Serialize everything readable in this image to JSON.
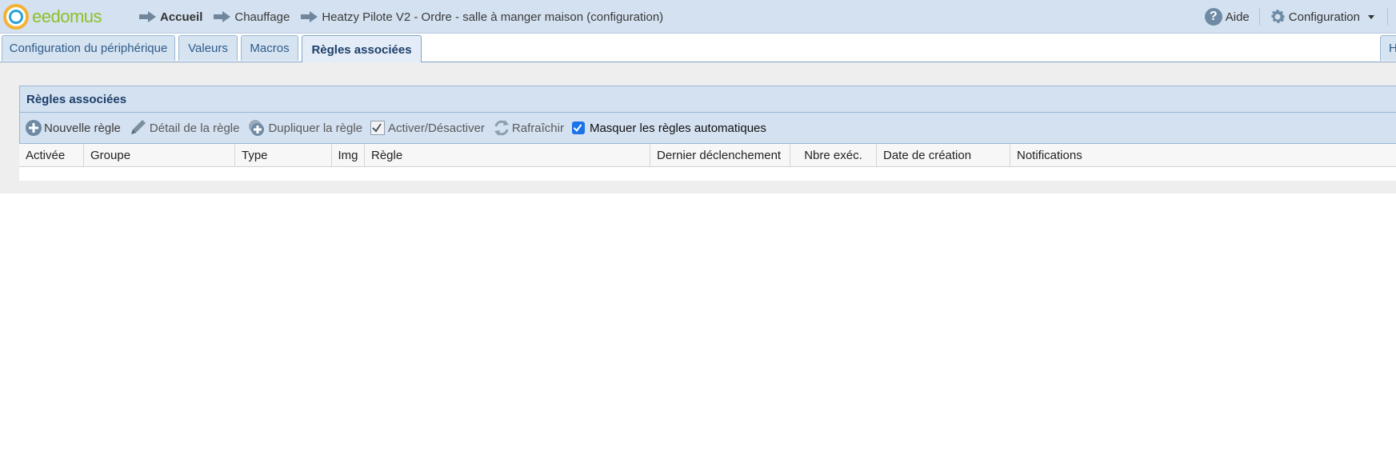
{
  "app": {
    "logo_text": "eedomus"
  },
  "breadcrumb": {
    "items": [
      "Accueil",
      "Chauffage",
      "Heatzy Pilote V2 - Ordre - salle à manger maison (configuration)"
    ]
  },
  "header": {
    "help_label": "Aide",
    "help_icon": "help-circle-icon",
    "config_label": "Configuration",
    "config_icon": "gear-icon"
  },
  "tabs": {
    "items": [
      "Configuration du périphérique",
      "Valeurs",
      "Macros",
      "Règles associées"
    ],
    "active": "Règles associées",
    "right_partial": "H"
  },
  "panel": {
    "title": "Règles associées"
  },
  "toolbar": {
    "new_rule": "Nouvelle règle",
    "rule_detail": "Détail de la règle",
    "duplicate_rule": "Dupliquer la règle",
    "toggle_rule": "Activer/Désactiver",
    "refresh": "Rafraîchir",
    "hide_auto_rules": "Masquer les règles automatiques",
    "hide_auto_rules_checked": true
  },
  "table": {
    "columns": [
      "Activée",
      "Groupe",
      "Type",
      "Img",
      "Règle",
      "Dernier déclenchement",
      "Nbre exéc.",
      "Date de création",
      "Notifications"
    ],
    "rows": []
  },
  "colors": {
    "header_bg": "#d3e1f0",
    "accent_text": "#1d3f6a",
    "logo_green": "#8fbf2a",
    "logo_orange": "#f2b233",
    "logo_blue": "#29a3d8",
    "checkbox_blue": "#1a73e8"
  }
}
